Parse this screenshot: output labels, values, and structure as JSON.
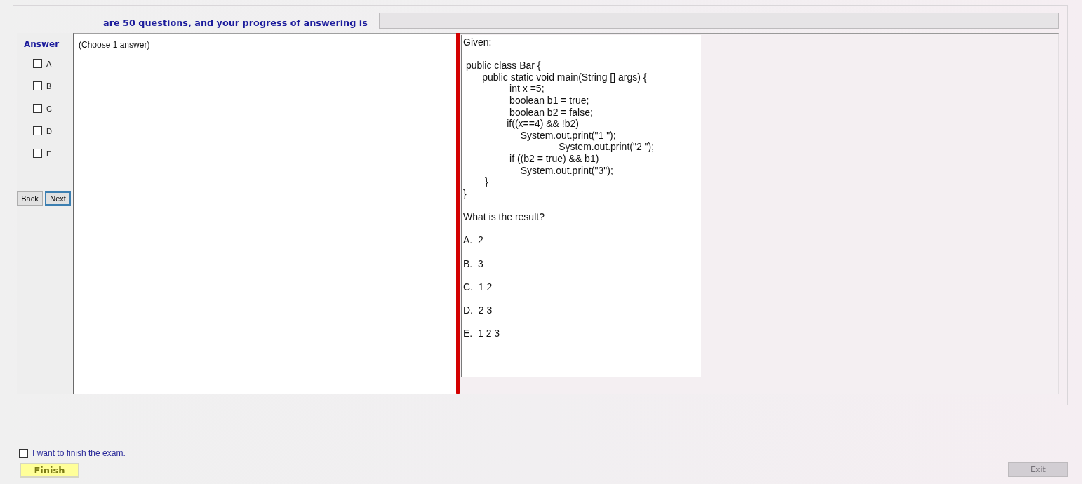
{
  "header": {
    "text": "are 50 questions, and your progress of answering is",
    "progress": {
      "level": 0
    }
  },
  "answer_panel": {
    "title": "Answer",
    "choices": [
      {
        "label": "A",
        "checked": false
      },
      {
        "label": "B",
        "checked": false
      },
      {
        "label": "C",
        "checked": false
      },
      {
        "label": "D",
        "checked": false
      },
      {
        "label": "E",
        "checked": false
      }
    ],
    "nav_buttons": [
      {
        "label": "Back",
        "focused": false
      },
      {
        "label": "Next",
        "focused": true
      }
    ]
  },
  "instruction": "(Choose 1 answer)",
  "question": {
    "intro": "Given:",
    "code": " public class Bar {\n       public static void main(String [] args) {\n                 int x =5;\n                 boolean b1 = true;\n                 boolean b2 = false;\n                if((x==4) && !b2)\n                     System.out.print(\"1 \");\n                                   System.out.print(\"2 \");\n                 if ((b2 = true) && b1)\n                     System.out.print(\"3\");\n        }\n}",
    "prompt": "What is the result?",
    "options": [
      "A.  2",
      "B.  3",
      "C.  1 2",
      "D.  2 3",
      "E.  1 2 3"
    ]
  },
  "finish_confirm": {
    "label": "I want to finish the exam.",
    "checked": false
  },
  "buttons": [
    {
      "label": "Finish",
      "kind": "finish",
      "disabled": false
    },
    {
      "label": "Exit",
      "kind": "exit",
      "disabled": true
    }
  ]
}
